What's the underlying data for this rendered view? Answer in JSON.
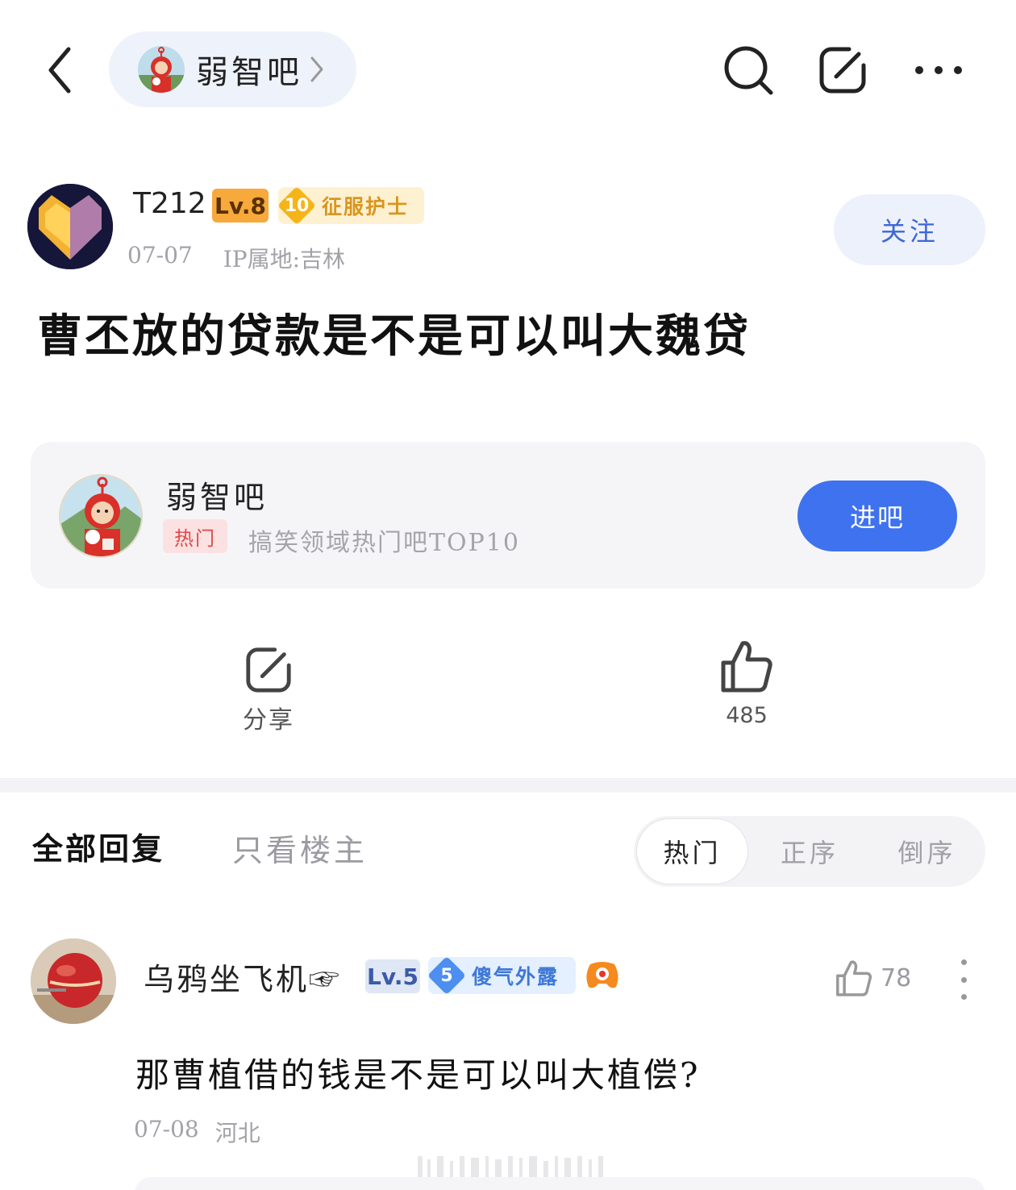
{
  "header": {
    "forum_name": "弱智吧",
    "icons": [
      "back-arrow-icon",
      "search-icon",
      "edit-icon",
      "more-icon"
    ]
  },
  "post": {
    "author": {
      "name": "T212",
      "level": "Lv.8",
      "title_level": "10",
      "title": "征服护士"
    },
    "date": "07-07",
    "ip_location": "IP属地:吉林",
    "follow_label": "关注",
    "title": "曹丕放的贷款是不是可以叫大魏贷"
  },
  "forum_card": {
    "name": "弱智吧",
    "tag": "热门",
    "description": "搞笑领域热门吧TOP10",
    "enter_label": "进吧"
  },
  "actions": {
    "share_label": "分享",
    "like_count": "485"
  },
  "tabs": {
    "all": "全部回复",
    "owner_only": "只看楼主",
    "sort": [
      "热门",
      "正序",
      "倒序"
    ],
    "active_sort": "热门"
  },
  "reply": {
    "author": {
      "name": "乌鸦坐飞机☞",
      "level": "Lv.5",
      "title_level": "5",
      "title": "傻气外露"
    },
    "like_count": "78",
    "text": "那曹植借的钱是不是可以叫大植偿?",
    "date": "07-08",
    "location": "河北"
  },
  "colors": {
    "accent_blue": "#3f72ee",
    "follow_text": "#3e66d8",
    "hot_tag": "#e04848",
    "level8_badge": "#f7a93b",
    "meta_gray": "#a2a2a8"
  }
}
